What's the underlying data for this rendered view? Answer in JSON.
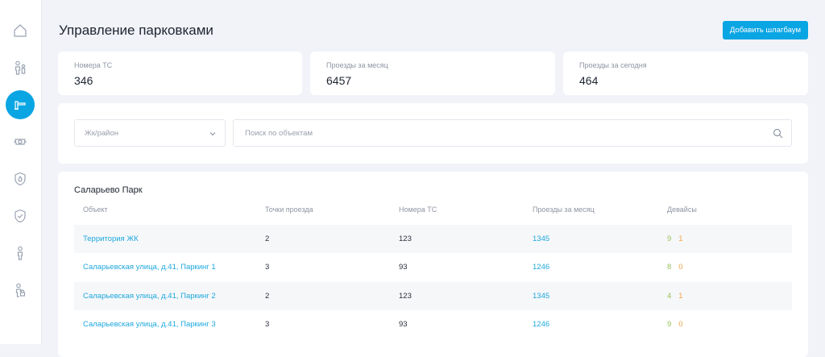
{
  "page": {
    "title": "Управление парковками",
    "add_button_label": "Добавить шлагбаум"
  },
  "sidebar": {
    "items": [
      {
        "icon": "home-icon",
        "active": false
      },
      {
        "icon": "people-icon",
        "active": false
      },
      {
        "icon": "barrier-icon",
        "active": true
      },
      {
        "icon": "camera-icon",
        "active": false
      },
      {
        "icon": "shield-fire-icon",
        "active": false
      },
      {
        "icon": "shield-check-icon",
        "active": false
      },
      {
        "icon": "person-icon",
        "active": false
      },
      {
        "icon": "person-lock-icon",
        "active": false
      }
    ]
  },
  "stats": [
    {
      "label": "Номера ТС",
      "value": "346"
    },
    {
      "label": "Проезды за месяц",
      "value": "6457"
    },
    {
      "label": "Проезды за сегодня",
      "value": "464"
    }
  ],
  "filters": {
    "district_placeholder": "Жк/район",
    "search_placeholder": "Поиск по объектам"
  },
  "group": {
    "title": "Саларьево Парк",
    "columns": [
      "Объект",
      "Точки проезда",
      "Номера ТС",
      "Проезды за месяц",
      "Девайсы"
    ],
    "rows": [
      {
        "object": "Территория ЖК",
        "points": "2",
        "plates": "123",
        "trips": "1345",
        "dev_ok": "9",
        "dev_warn": "1"
      },
      {
        "object": "Саларьевская улица, д.41, Паркинг 1",
        "points": "3",
        "plates": "93",
        "trips": "1246",
        "dev_ok": "8",
        "dev_warn": "0"
      },
      {
        "object": "Саларьевская улица, д.41, Паркинг 2",
        "points": "2",
        "plates": "123",
        "trips": "1345",
        "dev_ok": "4",
        "dev_warn": "1"
      },
      {
        "object": "Саларьевская улица, д.41, Паркинг 3",
        "points": "3",
        "plates": "93",
        "trips": "1246",
        "dev_ok": "9",
        "dev_warn": "0"
      }
    ]
  },
  "colors": {
    "accent": "#0aa5e3",
    "link": "#1da8dd",
    "device_ok": "#9bc15a",
    "device_warn": "#f0a347"
  }
}
